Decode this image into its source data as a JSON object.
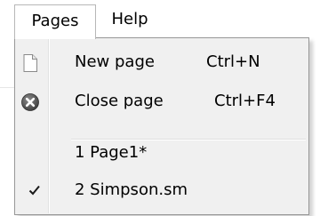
{
  "menubar": {
    "items": [
      {
        "label": "Pages"
      },
      {
        "label": "Help"
      }
    ]
  },
  "menu": {
    "items": [
      {
        "label": "New page",
        "shortcut": "Ctrl+N",
        "icon": "new-page-icon"
      },
      {
        "label": "Close page",
        "shortcut": "Ctrl+F4",
        "icon": "close-page-icon"
      },
      {
        "label": "1 Page1*",
        "shortcut": "",
        "icon": ""
      },
      {
        "label": "2 Simpson.sm",
        "shortcut": "",
        "icon": "checkmark-icon",
        "checked": true
      }
    ]
  },
  "colors": {
    "menu_bg": "#f0f0f0",
    "menu_border": "#979797",
    "text": "#000000"
  }
}
